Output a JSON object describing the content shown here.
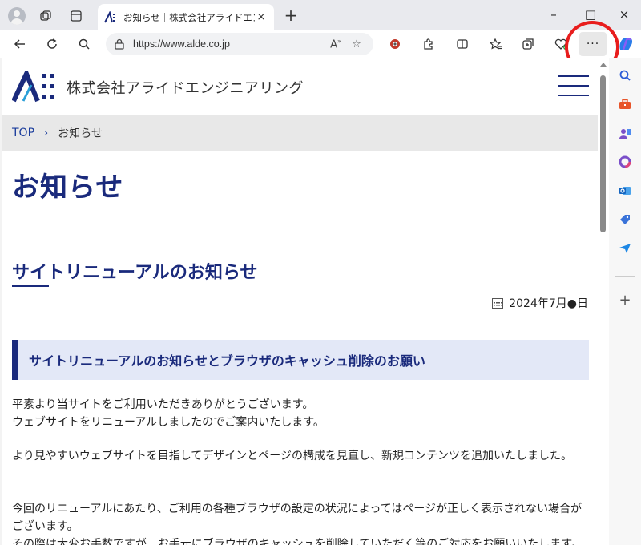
{
  "browser": {
    "tab_title": "お知らせ｜株式会社アライドエンジニ",
    "tab_close": "×",
    "new_tab": "+",
    "url": "https://www.alde.co.jp",
    "more_label": "···",
    "window": {
      "minimize": "–",
      "maximize": "□",
      "close": "×"
    }
  },
  "site": {
    "company_name": "株式会社アライドエンジニアリング",
    "breadcrumb": {
      "home": "TOP",
      "separator": "›",
      "current": "お知らせ"
    },
    "page_title": "お知らせ",
    "article_title": "サイトリニューアルのお知らせ",
    "date": "2024年7月●日",
    "notice_heading": "サイトリニューアルのお知らせとブラウザのキャッシュ削除のお願い",
    "paragraphs": [
      "平素より当サイトをご利用いただきありがとうございます。",
      "ウェブサイトをリニューアルしましたのでご案内いたします。",
      "より見やすいウェブサイトを目指してデザインとページの構成を見直し、新規コンテンツを追加いたしました。",
      "今回のリニューアルにあたり、ご利用の各種ブラウザの設定の状況によってはページが正しく表示されない場合がございます。",
      "その際は大変お手数ですが、お手元にブラウザのキャッシュを削除していただく等のご対応をお願いいたします。"
    ]
  },
  "colors": {
    "brand_navy": "#1a2a7c",
    "highlight": "#e81d1d",
    "notice_bg": "#e3e8f7"
  },
  "icons": [
    "back-icon",
    "refresh-icon",
    "search-icon",
    "lock-icon",
    "read-aloud-icon",
    "favorite-star-icon",
    "extension-icon",
    "puzzle-icon",
    "split-screen-icon",
    "favorites-icon",
    "collections-icon",
    "health-icon",
    "more-icon",
    "copilot-icon"
  ]
}
